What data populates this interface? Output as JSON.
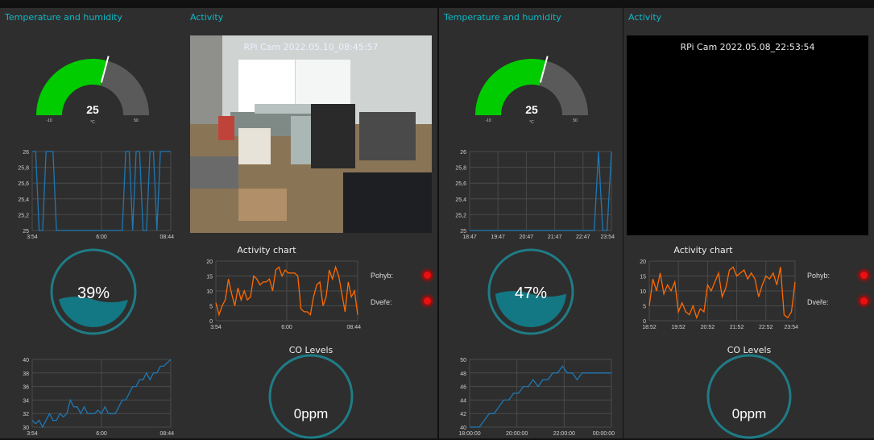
{
  "dashboards": [
    {
      "temp_panel_title": "Temperature and humidity",
      "activity_panel_title": "Activity",
      "gauge": {
        "value": "25",
        "unit": "°C",
        "min": "-10",
        "max": "50",
        "value_num": 25,
        "min_num": -10,
        "max_num": 50,
        "color": "#00cc00"
      },
      "humidity_level": {
        "value_num": 39,
        "label": "39%"
      },
      "camera": {
        "label": "RPi Cam 2022.05.10_08:45:57"
      },
      "activity_chart_title": "Activity chart",
      "co": {
        "title": "CO Levels",
        "value": "0ppm"
      },
      "status": {
        "motion_label": "Pohyb:",
        "door_label": "Dveře:"
      }
    },
    {
      "temp_panel_title": "Temperature and humidity",
      "activity_panel_title": "Activity",
      "gauge": {
        "value": "25",
        "unit": "°C",
        "min": "-10",
        "max": "50",
        "value_num": 25,
        "min_num": -10,
        "max_num": 50,
        "color": "#00cc00"
      },
      "humidity_level": {
        "value_num": 47,
        "label": "47%"
      },
      "camera": {
        "label": "RPi Cam 2022.05.08_22:53:54"
      },
      "activity_chart_title": "Activity chart",
      "co": {
        "title": "CO Levels",
        "value": "0ppm"
      },
      "status": {
        "motion_label": "Pohyb:",
        "door_label": "Dveře:"
      }
    }
  ],
  "chart_data": [
    {
      "type": "line",
      "dashboard": 1,
      "series_color": "#1f77b4",
      "x_ticks": [
        "3:54",
        "6:00",
        "08:44"
      ],
      "y_ticks": [
        "25",
        "25,2",
        "25,4",
        "25,6",
        "25,8",
        "26"
      ],
      "ylim": [
        25,
        26
      ],
      "values": [
        26,
        26,
        25,
        25,
        26,
        26,
        26,
        25,
        25,
        25,
        25,
        25,
        25,
        25,
        25,
        25,
        25,
        25,
        25,
        25,
        25,
        25,
        25,
        25,
        25,
        25,
        25,
        26,
        26,
        25,
        26,
        26,
        25,
        25,
        26,
        26,
        25,
        26,
        26,
        26,
        26
      ]
    },
    {
      "type": "line",
      "dashboard": 1,
      "series_color": "#1f77b4",
      "x_ticks": [
        "3:54",
        "6:00",
        "08:44"
      ],
      "y_ticks": [
        "30",
        "32",
        "34",
        "36",
        "38",
        "40"
      ],
      "ylim": [
        30,
        40
      ],
      "values": [
        31,
        30.5,
        31,
        30,
        31,
        32,
        31,
        31,
        32,
        31.5,
        32,
        34,
        33,
        33,
        32,
        33,
        32,
        32,
        32,
        32.5,
        32,
        33,
        32,
        32,
        32,
        33,
        34,
        34,
        35,
        36,
        36,
        37,
        37,
        38,
        37,
        38,
        38,
        39,
        39,
        39.5,
        40
      ]
    },
    {
      "type": "line",
      "dashboard": 1,
      "series_color": "#ff6a00",
      "x_ticks": [
        "3:54",
        "6:00",
        "08:44"
      ],
      "y_ticks": [
        "0",
        "5",
        "10",
        "15",
        "20"
      ],
      "ylim": [
        0,
        20
      ],
      "values": [
        6,
        2,
        5,
        7,
        14,
        9,
        5,
        11,
        7,
        10,
        7,
        8,
        15,
        14,
        12,
        13,
        13,
        14,
        10,
        17,
        18,
        15,
        17,
        16,
        16,
        16,
        15,
        4,
        3,
        3,
        2,
        8,
        12,
        13,
        5,
        8,
        17,
        14,
        18,
        15,
        9,
        3,
        13,
        8,
        10,
        2
      ]
    },
    {
      "type": "line",
      "dashboard": 2,
      "series_color": "#1f77b4",
      "x_ticks": [
        "18:47",
        "19:47",
        "20:47",
        "21:47",
        "22:47",
        "23:54"
      ],
      "y_ticks": [
        "25",
        "25,2",
        "25,4",
        "25,6",
        "25,8",
        "26"
      ],
      "ylim": [
        25,
        26
      ],
      "values": [
        25,
        25,
        25,
        25,
        25,
        25,
        25,
        25,
        25,
        25,
        25,
        25,
        25,
        25,
        25,
        25,
        25,
        25,
        25,
        25,
        25,
        25,
        25,
        25,
        25,
        25,
        25,
        25,
        25,
        25,
        26,
        25,
        25,
        26
      ]
    },
    {
      "type": "line",
      "dashboard": 2,
      "series_color": "#1f77b4",
      "x_ticks": [
        "18:00:00",
        "20:00:00",
        "22:00:00",
        "00:00:00"
      ],
      "y_ticks": [
        "40",
        "42",
        "44",
        "46",
        "48",
        "50"
      ],
      "ylim": [
        40,
        50
      ],
      "values": [
        40,
        40,
        40,
        41,
        42,
        42,
        43,
        44,
        44,
        45,
        45,
        46,
        46,
        47,
        46,
        47,
        47,
        48,
        48,
        49,
        48,
        48,
        47,
        48,
        48,
        48,
        48,
        48,
        48,
        48
      ]
    },
    {
      "type": "line",
      "dashboard": 2,
      "series_color": "#ff6a00",
      "x_ticks": [
        "18:52",
        "19:52",
        "20:52",
        "21:52",
        "22:52",
        "23:54"
      ],
      "y_ticks": [
        "0",
        "5",
        "10",
        "15",
        "20"
      ],
      "ylim": [
        0,
        20
      ],
      "values": [
        5,
        14,
        10,
        16,
        9,
        12,
        10,
        13,
        3,
        6,
        3,
        2,
        5,
        1,
        4,
        3,
        12,
        10,
        13,
        16,
        8,
        11,
        17,
        18,
        15,
        16,
        17,
        14,
        16,
        14,
        8,
        12,
        15,
        14,
        16,
        12,
        18,
        2,
        1,
        3,
        13
      ]
    }
  ]
}
